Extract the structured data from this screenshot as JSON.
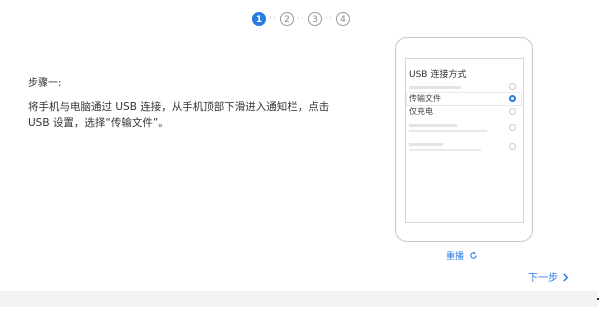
{
  "stepper": {
    "steps": [
      "1",
      "2",
      "3",
      "4"
    ],
    "separator": "··",
    "active_step": 1
  },
  "content": {
    "step_title": "步骤一:",
    "instruction": "将手机与电脑通过 USB 连接，从手机顶部下滑进入通知栏，点击 USB 设置，选择“传输文件”。"
  },
  "phone": {
    "title": "USB 连接方式",
    "options": [
      {
        "label": "",
        "selected": false
      },
      {
        "label": "传输文件",
        "selected": true
      },
      {
        "label": "仅充电",
        "selected": false
      },
      {
        "label": "",
        "selected": false
      },
      {
        "label": "",
        "selected": false
      }
    ]
  },
  "actions": {
    "rescan_label": "重播",
    "rescan_icon": "refresh-icon",
    "next_label": "下一步",
    "next_icon": "chevron-right-icon"
  },
  "colors": {
    "accent": "#2a7ae2",
    "text": "#333333",
    "footer_band": "#f2f3f5"
  }
}
